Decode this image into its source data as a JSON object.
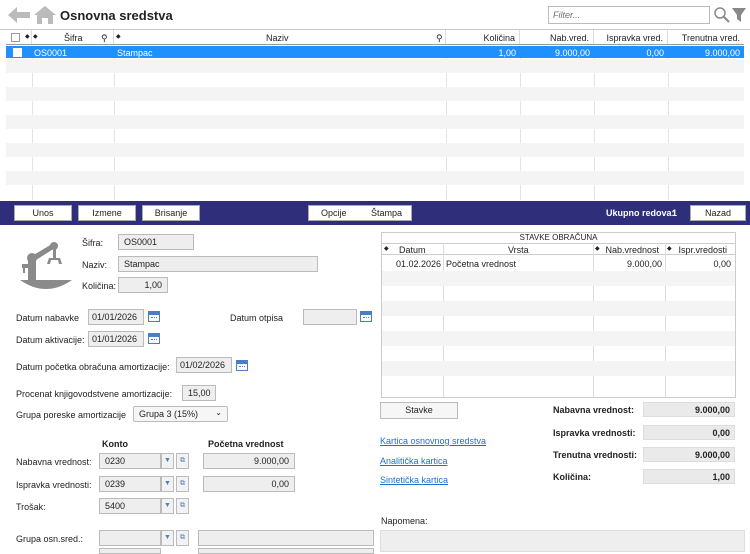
{
  "title": "Osnovna sredstva",
  "filter_placeholder": "Filter...",
  "grid": {
    "columns": {
      "sifra": "Šifra",
      "naziv": "Naziv",
      "kolicina": "Količina",
      "nab_vred": "Nab.vred.",
      "ispravka_vred": "Ispravka vred.",
      "trenutna_vred": "Trenutna vred."
    },
    "rows": [
      {
        "sifra": "OS0001",
        "naziv": "Stampac",
        "kolicina": "1,00",
        "nab_vred": "9.000,00",
        "ispravka_vred": "0,00",
        "trenutna_vred": "9.000,00"
      }
    ]
  },
  "toolbar": {
    "unos": "Unos",
    "izmene": "Izmene",
    "brisanje": "Brisanje",
    "opcije": "Opcije",
    "stampa": "Štampa",
    "ukupno_label": "Ukupno redova:",
    "ukupno_value": "1",
    "nazad": "Nazad"
  },
  "detail": {
    "sifra_label": "Šifra:",
    "sifra": "OS0001",
    "naziv_label": "Naziv:",
    "naziv": "Stampac",
    "kolicina_label": "Količina:",
    "kolicina": "1,00",
    "datum_nabavke_label": "Datum nabavke",
    "datum_nabavke": "01/01/2026",
    "datum_otpisa_label": "Datum otpisa",
    "datum_otpisa": "",
    "datum_aktivacije_label": "Datum aktivacije:",
    "datum_aktivacije": "01/01/2026",
    "datum_pocetka_label": "Datum početka obračuna amortizacije:",
    "datum_pocetka": "01/02/2026",
    "procenat_label": "Procenat knjigovodstvene amortizacije:",
    "procenat": "15,00",
    "grupa_poreske_label": "Grupa poreske amortizacije",
    "grupa_poreske": "Grupa 3 (15%)",
    "konto_header": "Konto",
    "pocetna_header": "Početna vrednost",
    "nabavna_label": "Nabavna vrednost:",
    "nabavna_konto": "0230",
    "nabavna_pocetna": "9.000,00",
    "ispravka_label": "Ispravka vrednosti:",
    "ispravka_konto": "0239",
    "ispravka_pocetna": "0,00",
    "trosak_label": "Trošak:",
    "trosak_konto": "5400",
    "grupa_osn_label": "Grupa osn.sred.:"
  },
  "stavke": {
    "title": "STAVKE OBRAČUNA",
    "columns": {
      "datum": "Datum",
      "vrsta": "Vrsta",
      "nab": "Nab.vrednost",
      "ispr": "Ispr.vredosti"
    },
    "rows": [
      {
        "datum": "01.02.2026",
        "vrsta": "Početna vrednost",
        "nab": "9.000,00",
        "ispr": "0,00"
      }
    ],
    "button": "Stavke"
  },
  "links": {
    "kartica": "Kartica osnovnog sredstva",
    "analiticka": "Analitička kartica",
    "sinteticka": "Sintetička kartica"
  },
  "summary": {
    "nabavna_label": "Nabavna vrednost:",
    "nabavna": "9.000,00",
    "ispravka_label": "Ispravka vrednosti:",
    "ispravka": "0,00",
    "trenutna_label": "Trenutna vrednosti:",
    "trenutna": "9.000,00",
    "kolicina_label": "Količina:",
    "kolicina": "1,00"
  },
  "napomena_label": "Napomena:",
  "colors": {
    "toolbar": "#2e2e7a",
    "selected_row": "#1e90ff",
    "link": "#1e6fd0"
  },
  "icons": [
    "back-arrow-icon",
    "home-icon",
    "search-icon",
    "filter-icon",
    "robot-arm-icon",
    "calendar-icon",
    "chevron-down-icon",
    "lookup-icon",
    "sort-icon",
    "checkbox-icon"
  ]
}
